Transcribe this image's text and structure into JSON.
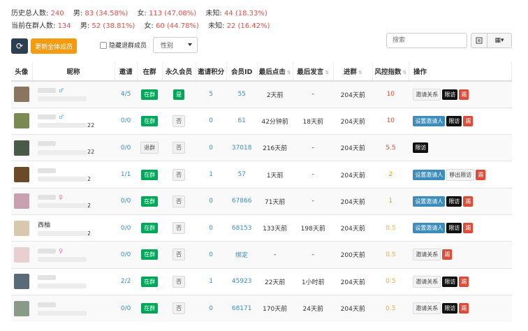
{
  "stats": {
    "history": {
      "label": "历史总人数:",
      "total": "240",
      "male_label": "男:",
      "male": "83 (34.58%)",
      "female_label": "女:",
      "female": "113 (47.08%)",
      "unknown_label": "未知:",
      "unknown": "44 (18.33%)"
    },
    "current": {
      "label": "当前在群人数:",
      "total": "134",
      "male_label": "男:",
      "male": "52 (38.81%)",
      "female_label": "女:",
      "female": "60 (44.78%)",
      "unknown_label": "未知:",
      "unknown": "22 (16.42%)"
    }
  },
  "toolbar": {
    "refresh_icon": "refresh-icon",
    "update_label": "更新全体成员",
    "hide_left_label": "隐藏退群成员",
    "gender_select": "性别",
    "search_placeholder": "搜索",
    "cols_icon": "▦▾"
  },
  "columns": [
    "头像",
    "昵称",
    "邀请",
    "在群",
    "永久会员",
    "邀请积分",
    "会员ID",
    "最后点击",
    "最后发言",
    "进群",
    "风控指数",
    "操作"
  ],
  "rows": [
    {
      "avatar_color": "#8a7560",
      "nick": "",
      "nick_sym": "♂",
      "sym_color": "#5aa9e6",
      "invite": "4/5",
      "ingroup": "在群",
      "ingroup_type": "green",
      "vip": "是",
      "vip_type": "green",
      "points": "5",
      "member_id": "55",
      "last_click": "2天前",
      "last_speak": "-",
      "joined": "204天前",
      "risk": "10",
      "risk_class": "risk-red",
      "ops": [
        [
          "邀请关系",
          "gray"
        ],
        [
          "限访",
          "black"
        ],
        [
          "踢",
          "red"
        ]
      ]
    },
    {
      "avatar_color": "#7a8a52",
      "nick": "",
      "nick_sym": "♂",
      "sym_color": "#5aa9e6",
      "nick_suffix": "22",
      "invite": "0/0",
      "ingroup": "在群",
      "ingroup_type": "green",
      "vip": "否",
      "vip_type": "gray",
      "points": "0",
      "member_id": "61",
      "last_click": "42分钟前",
      "last_speak": "18天前",
      "joined": "204天前",
      "risk": "10",
      "risk_class": "risk-red",
      "ops": [
        [
          "设置邀请人",
          "blue"
        ],
        [
          "限访",
          "black"
        ],
        [
          "踢",
          "red"
        ]
      ]
    },
    {
      "avatar_color": "#4a5a48",
      "nick": "",
      "nick_sym": "",
      "sym_color": "#5aa9e6",
      "nick_suffix": "22",
      "invite": "0/0",
      "ingroup": "退群",
      "ingroup_type": "gray",
      "vip": "否",
      "vip_type": "gray",
      "points": "0",
      "member_id": "37018",
      "last_click": "216天前",
      "last_speak": "-",
      "joined": "204天前",
      "risk": "5.5",
      "risk_class": "risk-red",
      "ops": [
        [
          "限访",
          "black"
        ]
      ]
    },
    {
      "avatar_color": "#6b4a2a",
      "nick": "",
      "nick_sym": "",
      "sym_color": "#5aa9e6",
      "nick_suffix": "2",
      "invite": "1/1",
      "ingroup": "在群",
      "ingroup_type": "green",
      "vip": "否",
      "vip_type": "gray",
      "points": "1",
      "member_id": "57",
      "last_click": "1天前",
      "last_speak": "-",
      "joined": "204天前",
      "risk": "2",
      "risk_class": "risk-orange",
      "ops": [
        [
          "设置邀请人",
          "blue"
        ],
        [
          "移出限访",
          "gray"
        ],
        [
          "踢",
          "red"
        ]
      ]
    },
    {
      "avatar_color": "#c9a0b0",
      "nick": "",
      "nick_sym": "♀",
      "sym_color": "#e66aa0",
      "nick_suffix": "2",
      "invite": "0/0",
      "ingroup": "在群",
      "ingroup_type": "green",
      "vip": "否",
      "vip_type": "gray",
      "points": "0",
      "member_id": "67866",
      "last_click": "71天前",
      "last_speak": "-",
      "joined": "204天前",
      "risk": "1",
      "risk_class": "risk-orange",
      "ops": [
        [
          "设置邀请人",
          "blue"
        ],
        [
          "限访",
          "black"
        ],
        [
          "踢",
          "red"
        ]
      ]
    },
    {
      "avatar_color": "#d8c8b0",
      "nick": "西柚",
      "nick_sym": "",
      "sym_color": "#5aa9e6",
      "nick_suffix": "2",
      "invite": "0/0",
      "ingroup": "在群",
      "ingroup_type": "green",
      "vip": "否",
      "vip_type": "gray",
      "points": "0",
      "member_id": "68153",
      "last_click": "133天前",
      "last_speak": "198天前",
      "joined": "204天前",
      "risk": "0.5",
      "risk_class": "risk-light",
      "ops": [
        [
          "设置邀请人",
          "blue"
        ],
        [
          "限访",
          "black"
        ],
        [
          "踢",
          "red"
        ]
      ]
    },
    {
      "avatar_color": "#e8d0d0",
      "nick": "",
      "nick_sym": "♀",
      "sym_color": "#e66aa0",
      "invite": "0/0",
      "ingroup": "在群",
      "ingroup_type": "green",
      "vip": "否",
      "vip_type": "gray",
      "points": "0",
      "member_id": "绑定",
      "last_click": "-",
      "last_speak": "-",
      "joined": "200天前",
      "risk": "0.5",
      "risk_class": "risk-light",
      "ops": [
        [
          "邀请关系",
          "gray"
        ],
        [
          "踢",
          "red"
        ]
      ]
    },
    {
      "avatar_color": "#5a6a78",
      "nick": "",
      "nick_sym": "",
      "sym_color": "#5aa9e6",
      "invite": "2/2",
      "ingroup": "在群",
      "ingroup_type": "green",
      "vip": "否",
      "vip_type": "gray",
      "points": "1",
      "member_id": "45923",
      "last_click": "22天前",
      "last_speak": "1小时前",
      "joined": "204天前",
      "risk": "0.5",
      "risk_class": "risk-light",
      "ops": [
        [
          "邀请关系",
          "gray"
        ],
        [
          "限访",
          "black"
        ],
        [
          "踢",
          "red"
        ]
      ]
    },
    {
      "avatar_color": "#8a9a88",
      "nick": "",
      "nick_sym": "",
      "sym_color": "#5aa9e6",
      "invite": "0/0",
      "ingroup": "在群",
      "ingroup_type": "green",
      "vip": "否",
      "vip_type": "gray",
      "points": "0",
      "member_id": "68171",
      "last_click": "170天前",
      "last_speak": "24天前",
      "joined": "204天前",
      "risk": "0.5",
      "risk_class": "risk-light",
      "ops": [
        [
          "邀请关系",
          "gray"
        ],
        [
          "限访",
          "black"
        ],
        [
          "踢",
          "red"
        ]
      ]
    }
  ]
}
